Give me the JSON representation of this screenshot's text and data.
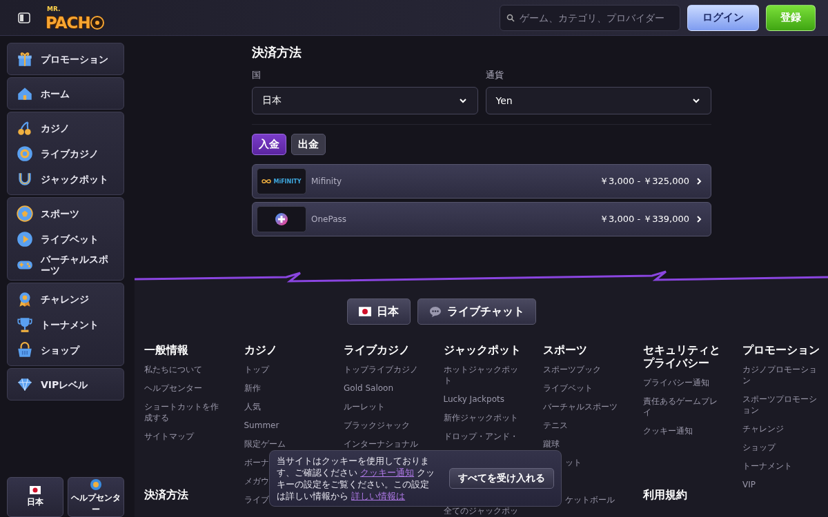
{
  "header": {
    "logo": {
      "small": "MR.",
      "main": "PACH"
    },
    "search": {
      "placeholder": "ゲーム、カテゴリ、プロバイダー"
    },
    "buttons": [
      {
        "label": "ログイン",
        "kind": "login"
      },
      {
        "label": "登録",
        "kind": "register"
      }
    ]
  },
  "sidebar": {
    "groups": [
      {
        "items": [
          {
            "label": "プロモーション"
          }
        ]
      },
      {
        "items": [
          {
            "label": "ホーム"
          }
        ]
      },
      {
        "items": [
          {
            "label": "カジノ"
          },
          {
            "label": "ライブカジノ"
          },
          {
            "label": "ジャックポット"
          }
        ]
      },
      {
        "items": [
          {
            "label": "スポーツ"
          },
          {
            "label": "ライブベット"
          },
          {
            "label": "バーチャルスポーツ"
          }
        ]
      },
      {
        "items": [
          {
            "label": "チャレンジ"
          },
          {
            "label": "トーナメント"
          },
          {
            "label": "ショップ"
          }
        ]
      },
      {
        "items": [
          {
            "label": "VIPレベル"
          }
        ]
      }
    ],
    "bottom": [
      {
        "label": "日本",
        "kind": "flag"
      },
      {
        "label": "ヘルプセンター",
        "kind": "help"
      }
    ]
  },
  "payment": {
    "title": "決済方法",
    "fields": [
      {
        "label": "国",
        "value": "日本"
      },
      {
        "label": "通貨",
        "value": "Yen"
      }
    ],
    "tabs": [
      {
        "label": "入金",
        "selected": true
      },
      {
        "label": "出金",
        "selected": false
      }
    ],
    "methods": [
      {
        "logo_text": "MiFINITY",
        "name": "Mifinity",
        "range": "￥3,000 - ￥325,000"
      },
      {
        "name": "OnePass",
        "range": "￥3,000 - ￥339,000"
      }
    ]
  },
  "footer": {
    "buttons": [
      {
        "label": "日本",
        "kind": "flag"
      },
      {
        "label": "ライブチャット",
        "kind": "chat"
      }
    ],
    "columns": [
      {
        "sections": [
          {
            "heading": "一般情報",
            "links": [
              {
                "label": "私たちについて",
                "kind": "link"
              },
              {
                "label": "ヘルプセンター",
                "kind": "link"
              },
              {
                "label": "ショートカットを作成する",
                "kind": "link"
              },
              {
                "label": "サイトマップ",
                "kind": "link"
              }
            ]
          },
          {
            "heading": "決済方法"
          }
        ]
      },
      {
        "sections": [
          {
            "heading": "カジノ",
            "links": [
              {
                "label": "トップ",
                "kind": "link"
              },
              {
                "label": "新作",
                "kind": "link"
              },
              {
                "label": "人気",
                "kind": "link"
              },
              {
                "label": "Summer",
                "kind": "link"
              },
              {
                "label": "限定ゲーム",
                "kind": "link"
              },
              {
                "label": "ボーナ",
                "kind": "link"
              },
              {
                "label": "メガウ",
                "kind": "link"
              },
              {
                "label": "ライブ",
                "kind": "link"
              }
            ]
          }
        ]
      },
      {
        "sections": [
          {
            "heading": "ライブカジノ",
            "links": [
              {
                "label": "トップライブカジノ",
                "kind": "link"
              },
              {
                "label": "Gold Saloon",
                "kind": "link"
              },
              {
                "label": "ルーレット",
                "kind": "link"
              },
              {
                "label": "ブラックジャック",
                "kind": "link"
              },
              {
                "label": "インターナショナル",
                "kind": "link"
              }
            ]
          }
        ]
      },
      {
        "sections": [
          {
            "heading": "ジャックポット",
            "links": [
              {
                "label": "ホットジャックポット",
                "kind": "link"
              },
              {
                "label": "Lucky Jackpots",
                "kind": "link"
              },
              {
                "label": "新作ジャックポット",
                "kind": "link"
              },
              {
                "label": "ドロップ・アンド・",
                "kind": "link"
              },
              {
                "kind": "gap"
              },
              {
                "kind": "gap"
              },
              {
                "kind": "gap"
              },
              {
                "label": "全てのジャックポッ",
                "kind": "link"
              }
            ]
          }
        ]
      },
      {
        "sections": [
          {
            "heading": "スポーツ",
            "links": [
              {
                "label": "スポーツブック",
                "kind": "link"
              },
              {
                "label": "ライブベット",
                "kind": "link"
              },
              {
                "label": "バーチャルスポーツ",
                "kind": "link"
              },
              {
                "label": "テニス",
                "kind": "link"
              },
              {
                "label": "蹴球",
                "kind": "link"
              },
              {
                "label": "ット",
                "kind": "clipped"
              },
              {
                "kind": "gap"
              },
              {
                "label": "ケットボール",
                "kind": "clipped"
              }
            ]
          }
        ]
      },
      {
        "sections": [
          {
            "heading": "セキュリティとプライバシー",
            "links": [
              {
                "label": "プライバシー通知",
                "kind": "link"
              },
              {
                "label": "責任あるゲームプレイ",
                "kind": "link"
              },
              {
                "label": "クッキー通知",
                "kind": "link"
              }
            ]
          },
          {
            "heading": "利用規約"
          }
        ]
      },
      {
        "sections": [
          {
            "heading": "プロモーション",
            "links": [
              {
                "label": "カジノプロモーション",
                "kind": "link"
              },
              {
                "label": "スポーツプロモーション",
                "kind": "link"
              },
              {
                "label": "チャレンジ",
                "kind": "link"
              },
              {
                "label": "ショップ",
                "kind": "link"
              },
              {
                "label": "トーナメント",
                "kind": "link"
              },
              {
                "label": "VIP",
                "kind": "link"
              }
            ]
          }
        ]
      }
    ]
  },
  "cookie_banner": {
    "message": [
      {
        "text": "当サイトはクッキーを使用しております、ご確認ください ",
        "kind": "text"
      },
      {
        "text": "クッキー通知",
        "kind": "link"
      },
      {
        "text": " クッキーの設定をご覧ください。この設定は詳しい情報から ",
        "kind": "text"
      },
      {
        "text": "詳しい情報は",
        "kind": "link"
      }
    ],
    "button": "すべてを受け入れる"
  }
}
